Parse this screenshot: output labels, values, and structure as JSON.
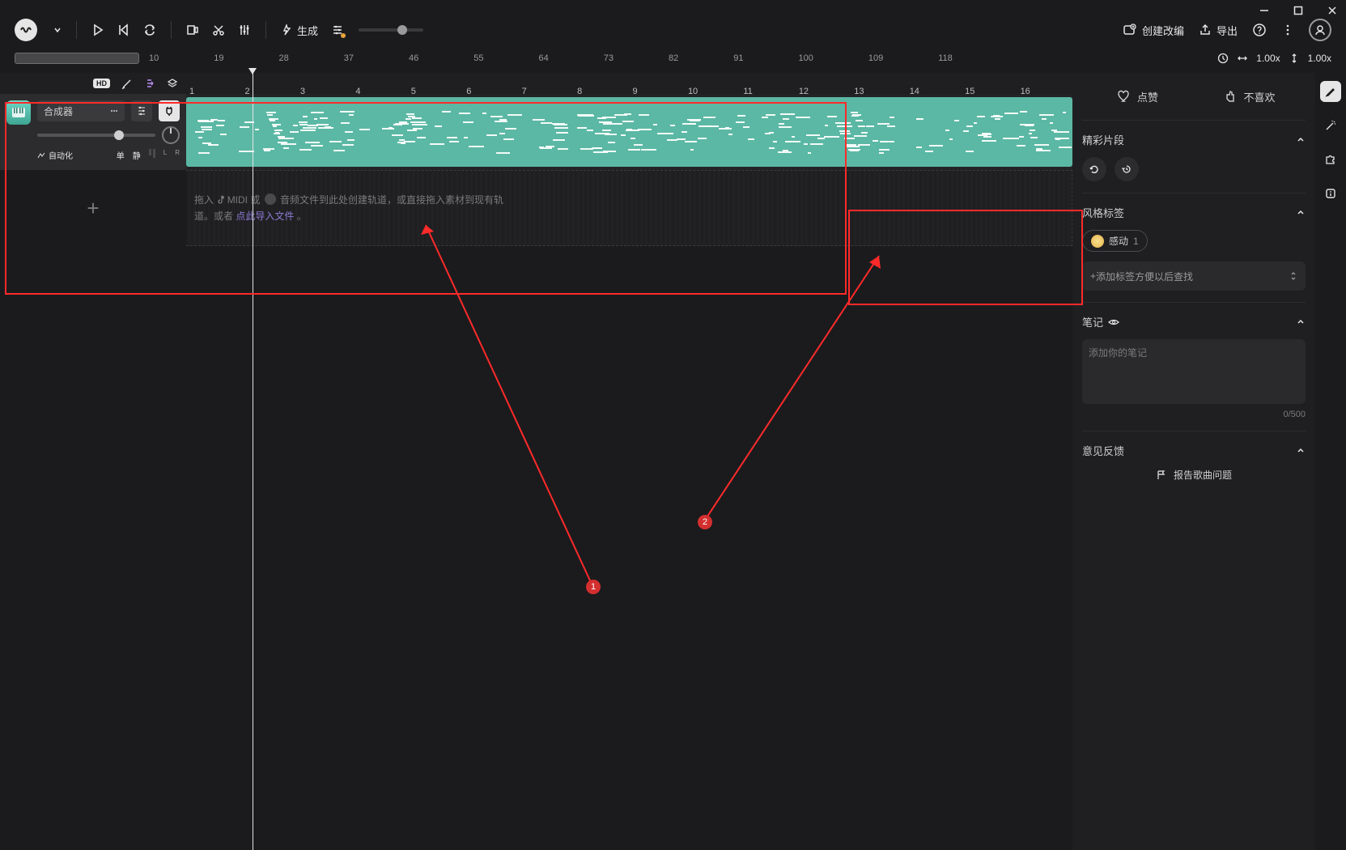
{
  "win": {
    "minimize": "−",
    "maximize": "□",
    "close": "×"
  },
  "toolbar": {
    "generate": "生成",
    "create_mod": "创建改编",
    "export": "导出"
  },
  "scrub": {
    "ticks": [
      "10",
      "19",
      "28",
      "37",
      "46",
      "55",
      "64",
      "73",
      "82",
      "91",
      "100",
      "109",
      "118"
    ],
    "zoom_h": "1.00x",
    "zoom_v": "1.00x"
  },
  "tlnums": [
    "1",
    "2",
    "3",
    "4",
    "5",
    "6",
    "7",
    "8",
    "9",
    "10",
    "11",
    "12",
    "13",
    "14",
    "15",
    "16"
  ],
  "track": {
    "name": "合成器",
    "automation": "自动化",
    "solo": "单",
    "mute": "静",
    "pan_l": "L",
    "pan_r": "R"
  },
  "dropzone": {
    "pre": "拖入 ",
    "midi": "MIDI",
    "or": " 或 ",
    "mid": " 音频文件到此处创建轨道，或直接拖入素材到现有轨道。或者 ",
    "link": "点此导入文件",
    "post": " 。"
  },
  "rpanel": {
    "like": "点赞",
    "dislike": "不喜欢",
    "highlights": "精彩片段",
    "style_tags": "风格标签",
    "tag_label": "感动",
    "tag_count": "1",
    "add_tag_prefix": "+ ",
    "add_tag": "添加标签方便以后查找",
    "notes": "笔记",
    "notes_placeholder": "添加你的笔记",
    "notes_count": "0/500",
    "feedback": "意见反馈",
    "report": "报告歌曲问题"
  },
  "annot": {
    "b1": "1",
    "b2": "2"
  }
}
